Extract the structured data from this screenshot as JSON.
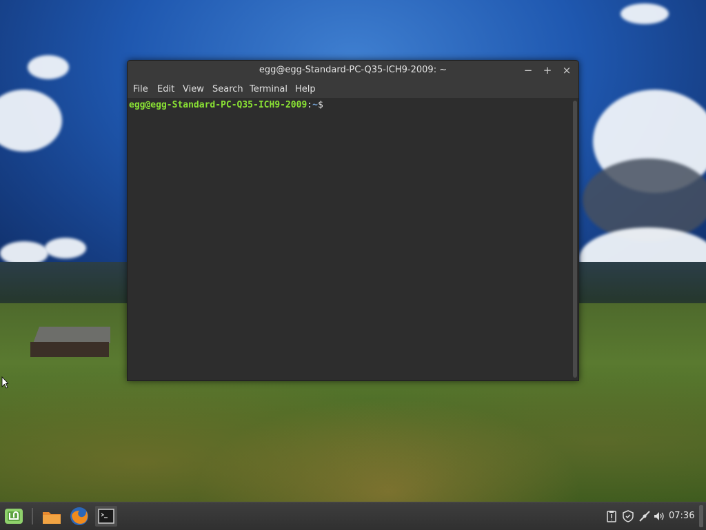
{
  "window": {
    "title": "egg@egg-Standard-PC-Q35-ICH9-2009: ~",
    "minimize_glyph": "−",
    "maximize_glyph": "+",
    "close_glyph": "×"
  },
  "menu": {
    "items": [
      "File",
      "Edit",
      "View",
      "Search",
      "Terminal",
      "Help"
    ]
  },
  "terminal": {
    "user_host": "egg@egg-Standard-PC-Q35-ICH9-2009",
    "separator": ":",
    "path": "~",
    "symbol": "$"
  },
  "panel": {
    "launchers": [
      "mint-menu-icon",
      "folder-icon",
      "firefox-icon",
      "terminal-icon"
    ],
    "tray": [
      "clipboard-icon",
      "shield-icon",
      "network-icon",
      "volume-icon"
    ],
    "clock": "07:36"
  },
  "colors": {
    "prompt_user": "#8ae234",
    "prompt_path": "#729fcf",
    "terminal_bg": "#2d2d2d"
  }
}
